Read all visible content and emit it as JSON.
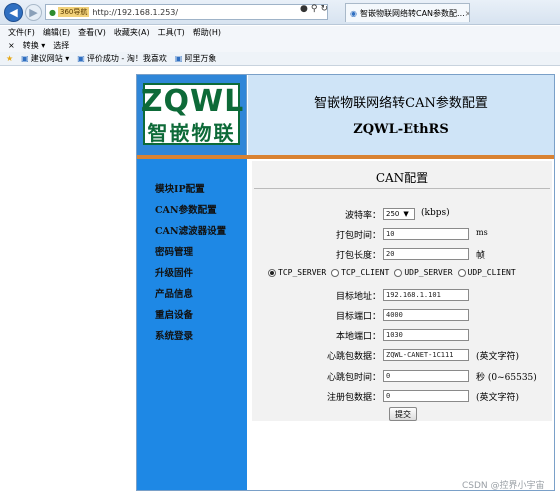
{
  "browser": {
    "mode_badge": "360导航",
    "url": "http://192.168.1.253/",
    "tab_title": "智嵌物联网络转CAN参数配...",
    "menu": [
      "文件(F)",
      "编辑(E)",
      "查看(V)",
      "收藏夹(A)",
      "工具(T)",
      "帮助(H)"
    ],
    "cmd": [
      "×",
      "转换 ▾",
      "选择"
    ],
    "favorites": [
      "建议网站 ▾",
      "评价成功 - 淘！我喜欢",
      "阿里万象"
    ]
  },
  "header": {
    "logo_top": "ZQWL",
    "logo_bottom": "智嵌物联",
    "title_cn": "智嵌物联网络转CAN参数配置",
    "title_en": "ZQWL-EthRS"
  },
  "sidebar": {
    "items": [
      "模块IP配置",
      "CAN参数配置",
      "CAN滤波器设置",
      "密码管理",
      "升级固件",
      "产品信息",
      "重启设备",
      "系统登录"
    ]
  },
  "main": {
    "title": "CAN配置",
    "baud": {
      "label": "波特率：",
      "value": "250",
      "unit": "(kbps)"
    },
    "pack_time": {
      "label": "打包时间：",
      "value": "10",
      "unit": "ms"
    },
    "pack_len": {
      "label": "打包长度：",
      "value": "20",
      "unit": "帧"
    },
    "modes": [
      "TCP_SERVER",
      "TCP_CLIENT",
      "UDP_SERVER",
      "UDP_CLIENT"
    ],
    "selected_mode": "TCP_SERVER",
    "target_ip": {
      "label": "目标地址：",
      "value": "192.168.1.101"
    },
    "target_port": {
      "label": "目标端口：",
      "value": "4000"
    },
    "local_port": {
      "label": "本地端口：",
      "value": "1030"
    },
    "heartbeat_data": {
      "label": "心跳包数据：",
      "value": "ZQWL-CANET-1C111",
      "unit": "(英文字符)"
    },
    "heartbeat_time": {
      "label": "心跳包时间：",
      "value": "0",
      "unit": "秒 (0~65535)"
    },
    "register_data": {
      "label": "注册包数据：",
      "value": "0",
      "unit": "(英文字符)"
    },
    "submit": "提交"
  },
  "watermark": "CSDN @控界小宇宙"
}
